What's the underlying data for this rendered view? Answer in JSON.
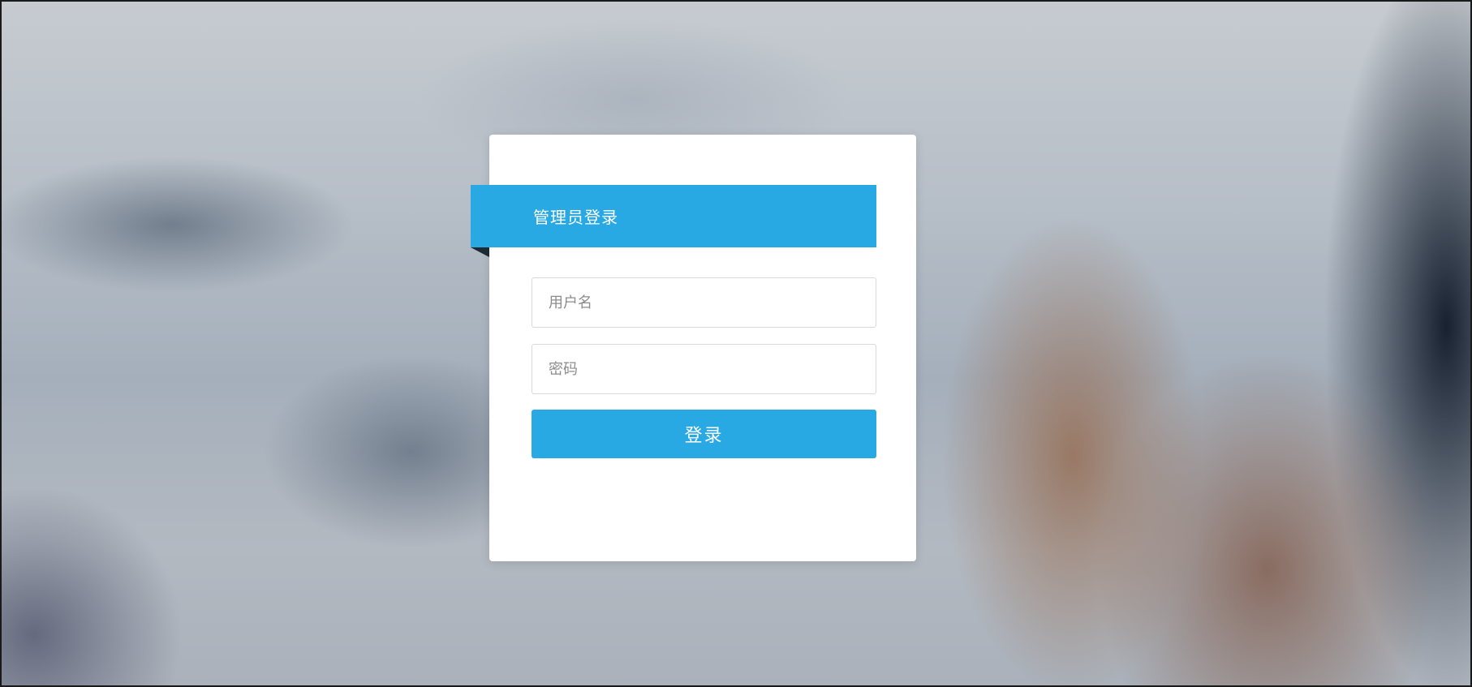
{
  "login": {
    "title": "管理员登录",
    "username_placeholder": "用户名",
    "password_placeholder": "密码",
    "submit_label": "登录"
  },
  "colors": {
    "accent": "#29a9e4",
    "card": "#ffffff",
    "input_border": "#d9d9d9",
    "placeholder": "#8c8c8c"
  }
}
